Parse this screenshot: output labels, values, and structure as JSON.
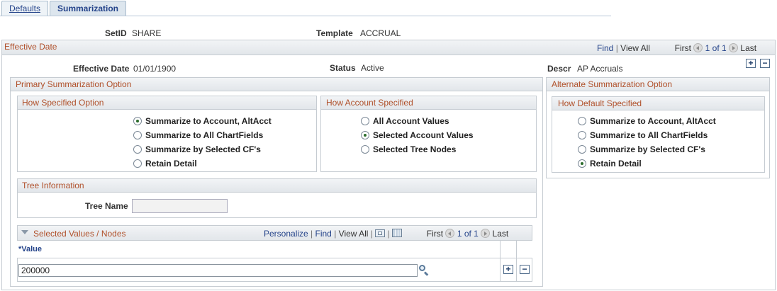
{
  "tabs": {
    "defaults": "Defaults",
    "summarization": "Summarization"
  },
  "header": {
    "setid_label": "SetID",
    "setid_value": "SHARE",
    "template_label": "Template",
    "template_value": "ACCRUAL"
  },
  "effective_date_bar": {
    "title": "Effective Date",
    "find": "Find",
    "view_all": "View All",
    "first": "First",
    "range": "1 of 1",
    "last": "Last"
  },
  "effective_row": {
    "eff_date_label": "Effective Date",
    "eff_date_value": "01/01/1900",
    "status_label": "Status",
    "status_value": "Active",
    "descr_label": "Descr",
    "descr_value": "AP Accruals"
  },
  "primary": {
    "title": "Primary Summarization Option",
    "how_specified": {
      "title": "How Specified Option",
      "options": [
        "Summarize to Account, AltAcct",
        "Summarize to All ChartFields",
        "Summarize by Selected CF's",
        "Retain Detail"
      ],
      "selected": 0
    },
    "how_account": {
      "title": "How Account Specified",
      "options": [
        "All Account Values",
        "Selected Account Values",
        "Selected Tree Nodes"
      ],
      "selected": 1
    },
    "tree_info": {
      "title": "Tree Information",
      "tree_name_label": "Tree Name",
      "tree_name_value": ""
    },
    "selected_values": {
      "title": "Selected Values / Nodes",
      "personalize": "Personalize",
      "find": "Find",
      "view_all": "View All",
      "first": "First",
      "range": "1 of 1",
      "last": "Last",
      "column_header": "*Value",
      "rows": [
        {
          "value": "200000"
        }
      ]
    }
  },
  "alternate": {
    "title": "Alternate Summarization Option",
    "how_default": {
      "title": "How Default Specified",
      "options": [
        "Summarize to Account, AltAcct",
        "Summarize to All ChartFields",
        "Summarize by Selected CF's",
        "Retain Detail"
      ],
      "selected": 3
    }
  },
  "buttons": {
    "add": "+",
    "remove": "−"
  },
  "colors": {
    "section_title": "#b0502a",
    "link": "#24438a",
    "bar_border": "#c6ccd2"
  }
}
